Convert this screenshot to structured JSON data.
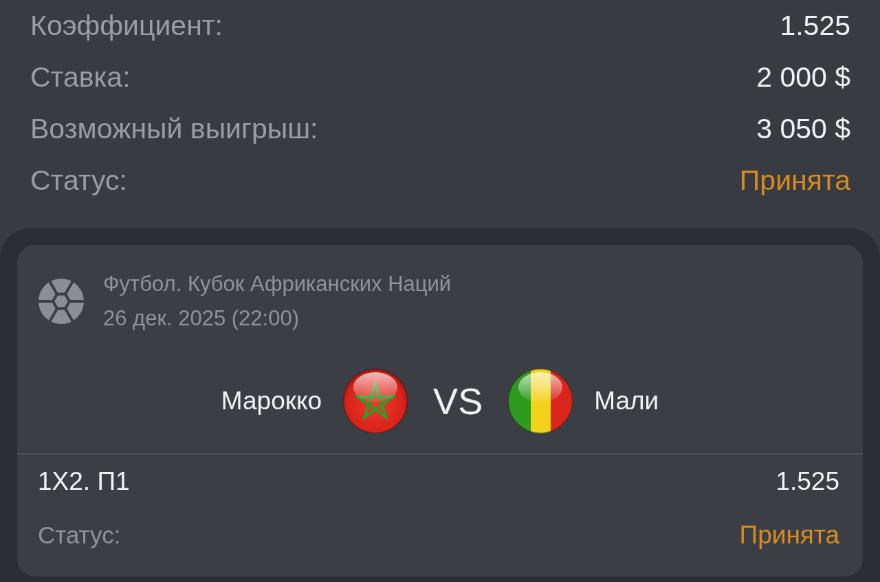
{
  "summary": [
    {
      "label": "Коэффициент:",
      "value": "1.525",
      "kind": "plain"
    },
    {
      "label": "Ставка:",
      "value": "2 000 $",
      "kind": "plain"
    },
    {
      "label": "Возможный выигрыш:",
      "value": "3 050 $",
      "kind": "plain"
    },
    {
      "label": "Статус:",
      "value": "Принята",
      "kind": "status"
    }
  ],
  "event": {
    "league": "Футбол. Кубок Африканских Наций",
    "date": "26 дек. 2025 (22:00)",
    "teams": [
      {
        "name": "Марокко",
        "kind": "star"
      },
      {
        "name": "Мали",
        "kind": "tricolor"
      }
    ],
    "versus": "VS",
    "lines": [
      {
        "label": "1X2. П1",
        "value": "1.525",
        "kind": "pick"
      },
      {
        "label": "Статус:",
        "value": "Принята",
        "kind": "status"
      }
    ]
  }
}
